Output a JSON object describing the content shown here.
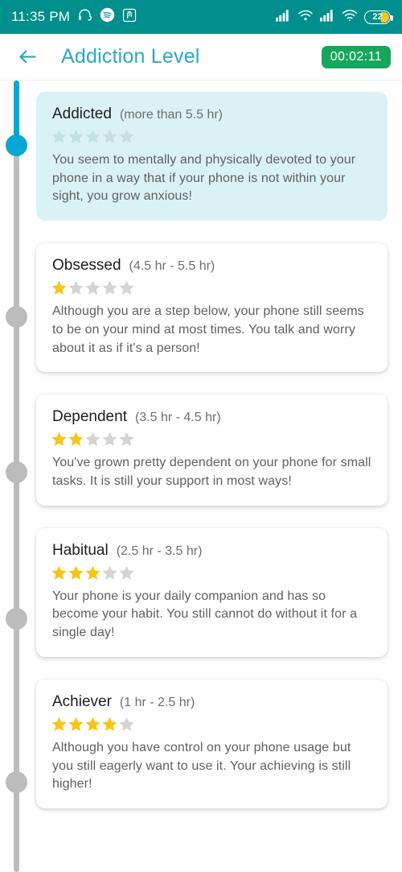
{
  "status_bar": {
    "time": "11:35 PM",
    "icons": [
      "headphones-icon",
      "spotify-icon",
      "app-icon"
    ],
    "right_icons": [
      "signal-bars-icon",
      "wifi-calling-icon",
      "signal-bars-2-icon",
      "wifi-icon"
    ],
    "battery_level": "22",
    "background_color": "#008f8c"
  },
  "header": {
    "back_label": "back-arrow",
    "title": "Addiction Level",
    "title_color": "#2aa8c4",
    "timer": "00:02:11",
    "timer_color": "#16a75c"
  },
  "timeline": {
    "active_color": "#06a7d4",
    "inactive_color": "#bcbcbc"
  },
  "levels": [
    {
      "name": "Addicted",
      "range": "(more than 5.5 hr)",
      "stars_filled": 0,
      "stars_total": 5,
      "description": "You seem to mentally and physically devoted to your phone in a way that if your phone is not within your sight, you grow anxious!",
      "highlighted": true
    },
    {
      "name": "Obsessed",
      "range": "(4.5 hr - 5.5 hr)",
      "stars_filled": 1,
      "stars_total": 5,
      "description": "Although you are a step below, your phone still seems to be on your mind at most times. You talk and worry about it as if it's a person!",
      "highlighted": false
    },
    {
      "name": "Dependent",
      "range": "(3.5 hr - 4.5 hr)",
      "stars_filled": 2,
      "stars_total": 5,
      "description": "You've grown pretty dependent on your phone for small tasks. It is still your support in most ways!",
      "highlighted": false
    },
    {
      "name": "Habitual",
      "range": "(2.5 hr - 3.5 hr)",
      "stars_filled": 3,
      "stars_total": 5,
      "description": "Your phone is your daily companion and has so become your habit. You still cannot do without it for a single day!",
      "highlighted": false
    },
    {
      "name": "Achiever",
      "range": "(1 hr - 2.5 hr)",
      "stars_filled": 4,
      "stars_total": 5,
      "description": "Although you have control on your phone usage but you still eagerly want to use it. Your achieving is still higher!",
      "highlighted": false
    }
  ],
  "star_colors": {
    "filled": "#f5c518",
    "empty": "#d4d4d4",
    "empty_on_highlight": "#c2dfe4"
  }
}
